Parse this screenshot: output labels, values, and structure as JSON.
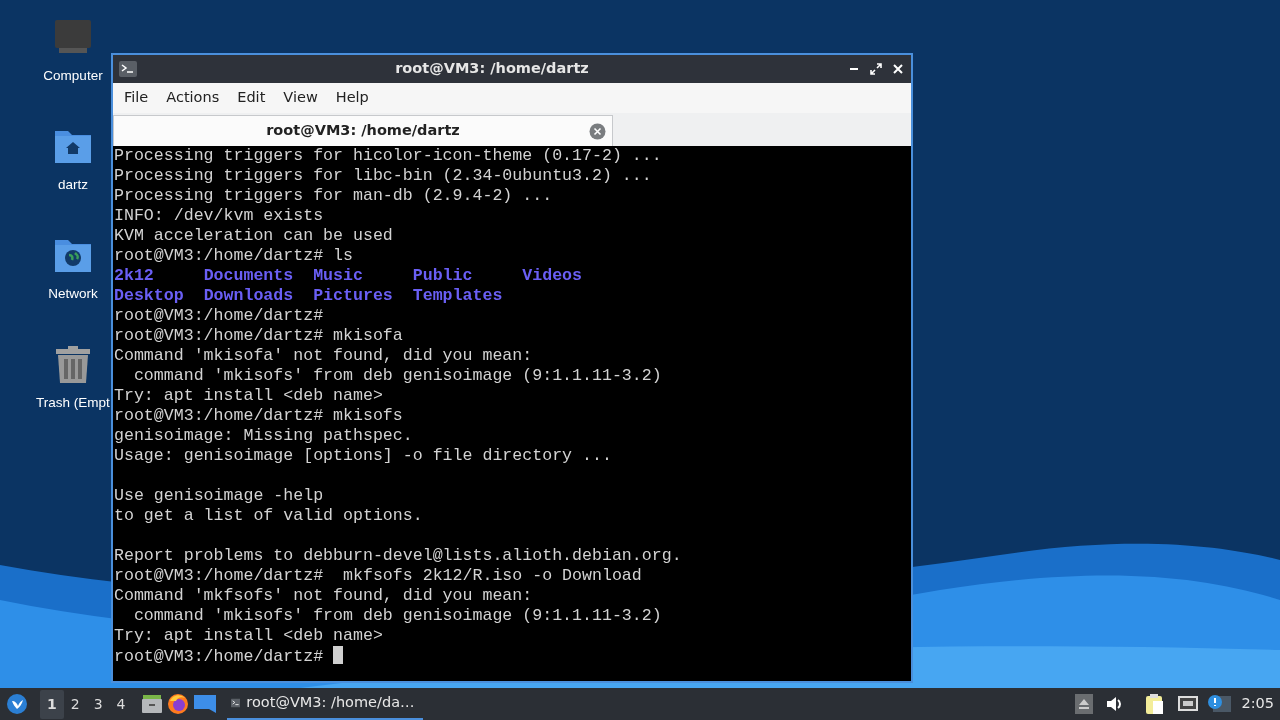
{
  "desktop": {
    "icons": [
      {
        "label": "Computer",
        "kind": "computer"
      },
      {
        "label": "dartz",
        "kind": "home"
      },
      {
        "label": "Network",
        "kind": "network"
      },
      {
        "label": "Trash (Empt",
        "kind": "trash"
      }
    ]
  },
  "window": {
    "title": "root@VM3: /home/dartz",
    "menu": [
      "File",
      "Actions",
      "Edit",
      "View",
      "Help"
    ],
    "tabs": [
      {
        "label": "root@VM3: /home/dartz",
        "selected": true
      }
    ],
    "terminal": {
      "cursor": true,
      "lines": [
        {
          "kind": "text",
          "text": "Processing triggers for hicolor-icon-theme (0.17-2) ..."
        },
        {
          "kind": "text",
          "text": "Processing triggers for libc-bin (2.34-0ubuntu3.2) ..."
        },
        {
          "kind": "text",
          "text": "Processing triggers for man-db (2.9.4-2) ..."
        },
        {
          "kind": "text",
          "text": "INFO: /dev/kvm exists"
        },
        {
          "kind": "text",
          "text": "KVM acceleration can be used"
        },
        {
          "kind": "text",
          "text": "root@VM3:/home/dartz# ls"
        },
        {
          "kind": "dirs",
          "items": [
            "2k12",
            "Documents",
            "Music",
            "Public",
            "Videos"
          ]
        },
        {
          "kind": "dirs",
          "items": [
            "Desktop",
            "Downloads",
            "Pictures",
            "Templates"
          ]
        },
        {
          "kind": "text",
          "text": "root@VM3:/home/dartz#"
        },
        {
          "kind": "text",
          "text": "root@VM3:/home/dartz# mkisofa"
        },
        {
          "kind": "text",
          "text": "Command 'mkisofa' not found, did you mean:"
        },
        {
          "kind": "text",
          "text": "  command 'mkisofs' from deb genisoimage (9:1.1.11-3.2)"
        },
        {
          "kind": "text",
          "text": "Try: apt install <deb name>"
        },
        {
          "kind": "text",
          "text": "root@VM3:/home/dartz# mkisofs"
        },
        {
          "kind": "text",
          "text": "genisoimage: Missing pathspec."
        },
        {
          "kind": "text",
          "text": "Usage: genisoimage [options] -o file directory ..."
        },
        {
          "kind": "blank"
        },
        {
          "kind": "text",
          "text": "Use genisoimage -help"
        },
        {
          "kind": "text",
          "text": "to get a list of valid options."
        },
        {
          "kind": "blank"
        },
        {
          "kind": "text",
          "text": "Report problems to debburn-devel@lists.alioth.debian.org."
        },
        {
          "kind": "text",
          "text": "root@VM3:/home/dartz#  mkfsofs 2k12/R.iso -o Download"
        },
        {
          "kind": "text",
          "text": "Command 'mkfsofs' not found, did you mean:"
        },
        {
          "kind": "text",
          "text": "  command 'mkisofs' from deb genisoimage (9:1.1.11-3.2)"
        },
        {
          "kind": "text",
          "text": "Try: apt install <deb name>"
        },
        {
          "kind": "text",
          "text": "root@VM3:/home/dartz# "
        }
      ]
    }
  },
  "taskbar": {
    "workspaces": [
      {
        "label": "1",
        "selected": true
      },
      {
        "label": "2",
        "selected": false
      },
      {
        "label": "3",
        "selected": false
      },
      {
        "label": "4",
        "selected": false
      }
    ],
    "tasks": [
      {
        "label": "root@VM3: /home/da…",
        "selected": true
      }
    ],
    "clock": "2:05"
  }
}
